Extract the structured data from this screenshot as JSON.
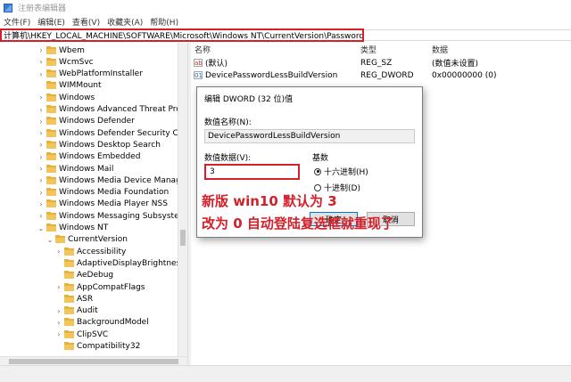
{
  "window": {
    "title": "注册表编辑器"
  },
  "menu": [
    "文件(F)",
    "编辑(E)",
    "查看(V)",
    "收藏夹(A)",
    "帮助(H)"
  ],
  "address": "计算机\\HKEY_LOCAL_MACHINE\\SOFTWARE\\Microsoft\\Windows NT\\CurrentVersion\\PasswordLess\\Device",
  "tree": [
    {
      "label": "Wbem",
      "depth": 0,
      "expander": ">"
    },
    {
      "label": "WcmSvc",
      "depth": 0,
      "expander": ">"
    },
    {
      "label": "WebPlatformInstaller",
      "depth": 0,
      "expander": ">"
    },
    {
      "label": "WIMMount",
      "depth": 0,
      "expander": ""
    },
    {
      "label": "Windows",
      "depth": 0,
      "expander": ">"
    },
    {
      "label": "Windows Advanced Threat Protect",
      "depth": 0,
      "expander": ">"
    },
    {
      "label": "Windows Defender",
      "depth": 0,
      "expander": ">"
    },
    {
      "label": "Windows Defender Security Center",
      "depth": 0,
      "expander": ">"
    },
    {
      "label": "Windows Desktop Search",
      "depth": 0,
      "expander": ">"
    },
    {
      "label": "Windows Embedded",
      "depth": 0,
      "expander": ">"
    },
    {
      "label": "Windows Mail",
      "depth": 0,
      "expander": ">"
    },
    {
      "label": "Windows Media Device Manager",
      "depth": 0,
      "expander": ">"
    },
    {
      "label": "Windows Media Foundation",
      "depth": 0,
      "expander": ">"
    },
    {
      "label": "Windows Media Player NSS",
      "depth": 0,
      "expander": ">"
    },
    {
      "label": "Windows Messaging Subsystem",
      "depth": 0,
      "expander": ">"
    },
    {
      "label": "Windows NT",
      "depth": 0,
      "expander": "v"
    },
    {
      "label": "CurrentVersion",
      "depth": 1,
      "expander": "v"
    },
    {
      "label": "Accessibility",
      "depth": 2,
      "expander": ">"
    },
    {
      "label": "AdaptiveDisplayBrightness",
      "depth": 2,
      "expander": ""
    },
    {
      "label": "AeDebug",
      "depth": 2,
      "expander": ""
    },
    {
      "label": "AppCompatFlags",
      "depth": 2,
      "expander": ">"
    },
    {
      "label": "ASR",
      "depth": 2,
      "expander": ""
    },
    {
      "label": "Audit",
      "depth": 2,
      "expander": ">"
    },
    {
      "label": "BackgroundModel",
      "depth": 2,
      "expander": ">"
    },
    {
      "label": "ClipSVC",
      "depth": 2,
      "expander": ">"
    },
    {
      "label": "Compatibility32",
      "depth": 2,
      "expander": ""
    }
  ],
  "values": {
    "headers": {
      "name": "名称",
      "type": "类型",
      "data": "数据"
    },
    "rows": [
      {
        "icon": "ab",
        "icon_name": "string-value-icon",
        "name": "(默认)",
        "type": "REG_SZ",
        "data": "(数值未设置)"
      },
      {
        "icon": "01",
        "icon_name": "binary-value-icon",
        "name": "DevicePasswordLessBuildVersion",
        "type": "REG_DWORD",
        "data": "0x00000000 (0)"
      }
    ]
  },
  "dialog": {
    "title": "编辑 DWORD (32 位)值",
    "name_label": "数值名称(N):",
    "name_value": "DevicePasswordLessBuildVersion",
    "data_label": "数值数据(V):",
    "data_value": "3",
    "base_label": "基数",
    "hex_label": "十六进制(H)",
    "dec_label": "十进制(D)",
    "ok": "确定",
    "cancel": "取消"
  },
  "annotation": {
    "line1": "新版 win10 默认为 3",
    "line2": "改为 0 自动登陆复选框就重现了",
    "color": "#d4202a"
  }
}
